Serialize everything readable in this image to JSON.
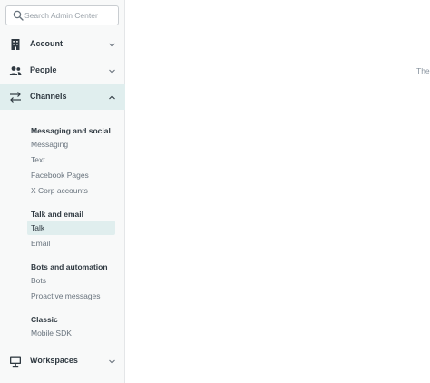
{
  "search": {
    "placeholder": "Search Admin Center",
    "value": ""
  },
  "nav": {
    "account": {
      "label": "Account",
      "icon": "building-icon"
    },
    "people": {
      "label": "People",
      "icon": "people-icon"
    },
    "channels": {
      "label": "Channels",
      "icon": "channels-arrows-icon",
      "expanded": true
    },
    "workspaces": {
      "label": "Workspaces",
      "icon": "monitor-icon"
    }
  },
  "channels_menu": {
    "groups": [
      {
        "title": "Messaging and social",
        "items": [
          "Messaging",
          "Text",
          "Facebook Pages",
          "X Corp accounts"
        ]
      },
      {
        "title": "Talk and email",
        "items": [
          "Talk",
          "Email"
        ]
      },
      {
        "title": "Bots and automation",
        "items": [
          "Bots",
          "Proactive messages"
        ]
      },
      {
        "title": "Classic",
        "items": [
          "Mobile SDK"
        ]
      }
    ],
    "selected": "Talk"
  },
  "main": {
    "text": "The"
  },
  "colors": {
    "active_bg": "#e0eeee",
    "sidebar_bg": "#f8f9f9",
    "text": "#2f3941",
    "muted": "#68737d"
  }
}
